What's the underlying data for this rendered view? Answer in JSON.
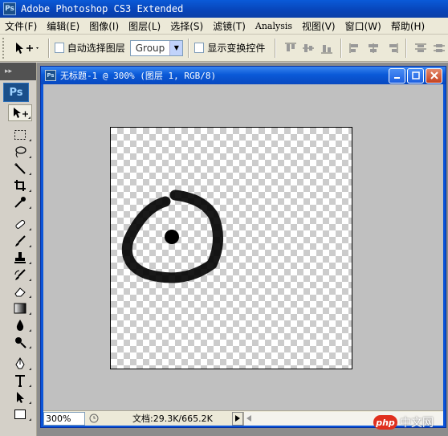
{
  "app": {
    "title": "Adobe Photoshop CS3 Extended",
    "logo_text": "Ps"
  },
  "menubar": {
    "items": [
      {
        "label": "文件(F)"
      },
      {
        "label": "编辑(E)"
      },
      {
        "label": "图像(I)"
      },
      {
        "label": "图层(L)"
      },
      {
        "label": "选择(S)"
      },
      {
        "label": "滤镜(T)"
      },
      {
        "label": "Analysis"
      },
      {
        "label": "视图(V)"
      },
      {
        "label": "窗口(W)"
      },
      {
        "label": "帮助(H)"
      }
    ]
  },
  "options": {
    "auto_select_label": "自动选择图层",
    "auto_select_value": "Group",
    "show_transform_label": "显示变换控件"
  },
  "toolbox": {
    "logo_text": "Ps",
    "tools": [
      {
        "icon": "move-tool-icon"
      },
      {
        "icon": "marquee-tool-icon"
      },
      {
        "icon": "lasso-tool-icon"
      },
      {
        "icon": "magic-wand-icon"
      },
      {
        "icon": "crop-tool-icon"
      },
      {
        "icon": "eyedropper-icon"
      },
      {
        "icon": "healing-brush-icon"
      },
      {
        "icon": "brush-tool-icon"
      },
      {
        "icon": "clone-stamp-icon"
      },
      {
        "icon": "history-brush-icon"
      },
      {
        "icon": "eraser-icon"
      },
      {
        "icon": "gradient-tool-icon"
      },
      {
        "icon": "blur-tool-icon"
      },
      {
        "icon": "dodge-tool-icon"
      },
      {
        "icon": "pen-tool-icon"
      },
      {
        "icon": "type-tool-icon"
      },
      {
        "icon": "path-selection-icon"
      },
      {
        "icon": "rectangle-shape-icon"
      }
    ]
  },
  "document": {
    "title": "无标题-1 @ 300% (图层 1, RGB/8)",
    "logo_text": "Ps",
    "zoom": "300%",
    "doc_info": "文档:29.3K/665.2K"
  },
  "watermark": {
    "logo_text": "php",
    "text": "中文网"
  },
  "colors": {
    "titlebar": "#0a5ad8",
    "canvas_bg": "#c0c0c0",
    "stroke": "#000000"
  }
}
